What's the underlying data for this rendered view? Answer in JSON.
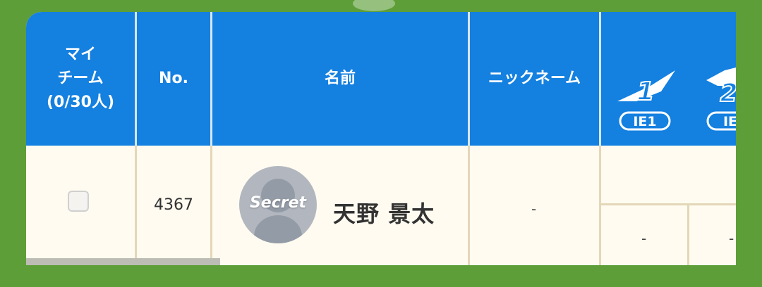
{
  "header": {
    "myteam": [
      "マイ",
      "チーム",
      "(0/30人)"
    ],
    "no": "No.",
    "name": "名前",
    "nickname": "ニックネーム",
    "badge1": {
      "num": "1",
      "label": "IE1"
    },
    "badge2": {
      "num": "2",
      "label": "IE"
    }
  },
  "row": {
    "number": "4367",
    "avatar_label": "Secret",
    "player_name": "天野 景太",
    "nickname": "-",
    "stat1": "-",
    "stat2": "-"
  },
  "colors": {
    "header_bg": "#1480e0",
    "page_bg": "#5d9e38",
    "row_bg": "#fffbf0"
  }
}
